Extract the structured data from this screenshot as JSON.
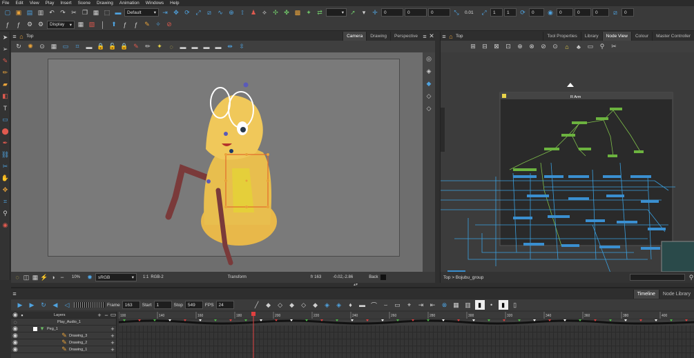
{
  "menu": [
    "File",
    "Edit",
    "View",
    "Play",
    "Insert",
    "Scene",
    "Drawing",
    "Animation",
    "Windows",
    "Help"
  ],
  "toolbar1": {
    "workspace": "Default",
    "fields": [
      "0",
      "0",
      "0",
      "0.01",
      "1",
      "1",
      "0",
      "0",
      "0",
      "0",
      "0"
    ]
  },
  "toolbar2": {
    "display": "Display"
  },
  "camera_view": {
    "title": "Top",
    "tabs": [
      "Camera",
      "Drawing",
      "Perspective"
    ],
    "active_tab": "Camera",
    "status": {
      "zoom": "10%",
      "color_space": "sRGB",
      "ratio": "1:1",
      "rgb": "RGB-2",
      "mode": "Transform",
      "frame_readout": "fr 163",
      "coords": "-0.02,-2.86",
      "back": "Back"
    }
  },
  "node_view": {
    "title": "Top",
    "tabs": [
      "Tool Properties",
      "Library",
      "Node View",
      "Colour",
      "Master Controller"
    ],
    "active_tab": "Node View",
    "group_title": "R Arm",
    "breadcrumb": "Top > Bojubu_group"
  },
  "timeline": {
    "tabs": [
      "Timeline",
      "Node Library"
    ],
    "active_tab": "Timeline",
    "frame_label": "Frame",
    "frame": "163",
    "start_label": "Start",
    "start": "1",
    "stop_label": "Stop",
    "stop": "549",
    "fps_label": "FPS",
    "fps": "24",
    "layers_label": "Layers",
    "layers": [
      "Play_Audio_1",
      "Peg_1",
      "Drawing_3",
      "Drawing_2",
      "Drawing_1"
    ],
    "ruler": [
      "100",
      "140",
      "160",
      "180",
      "200",
      "220",
      "240",
      "260",
      "280",
      "300",
      "320",
      "340",
      "360",
      "380",
      "400"
    ],
    "playhead_frame": 163
  },
  "accent": "#e36a2a"
}
